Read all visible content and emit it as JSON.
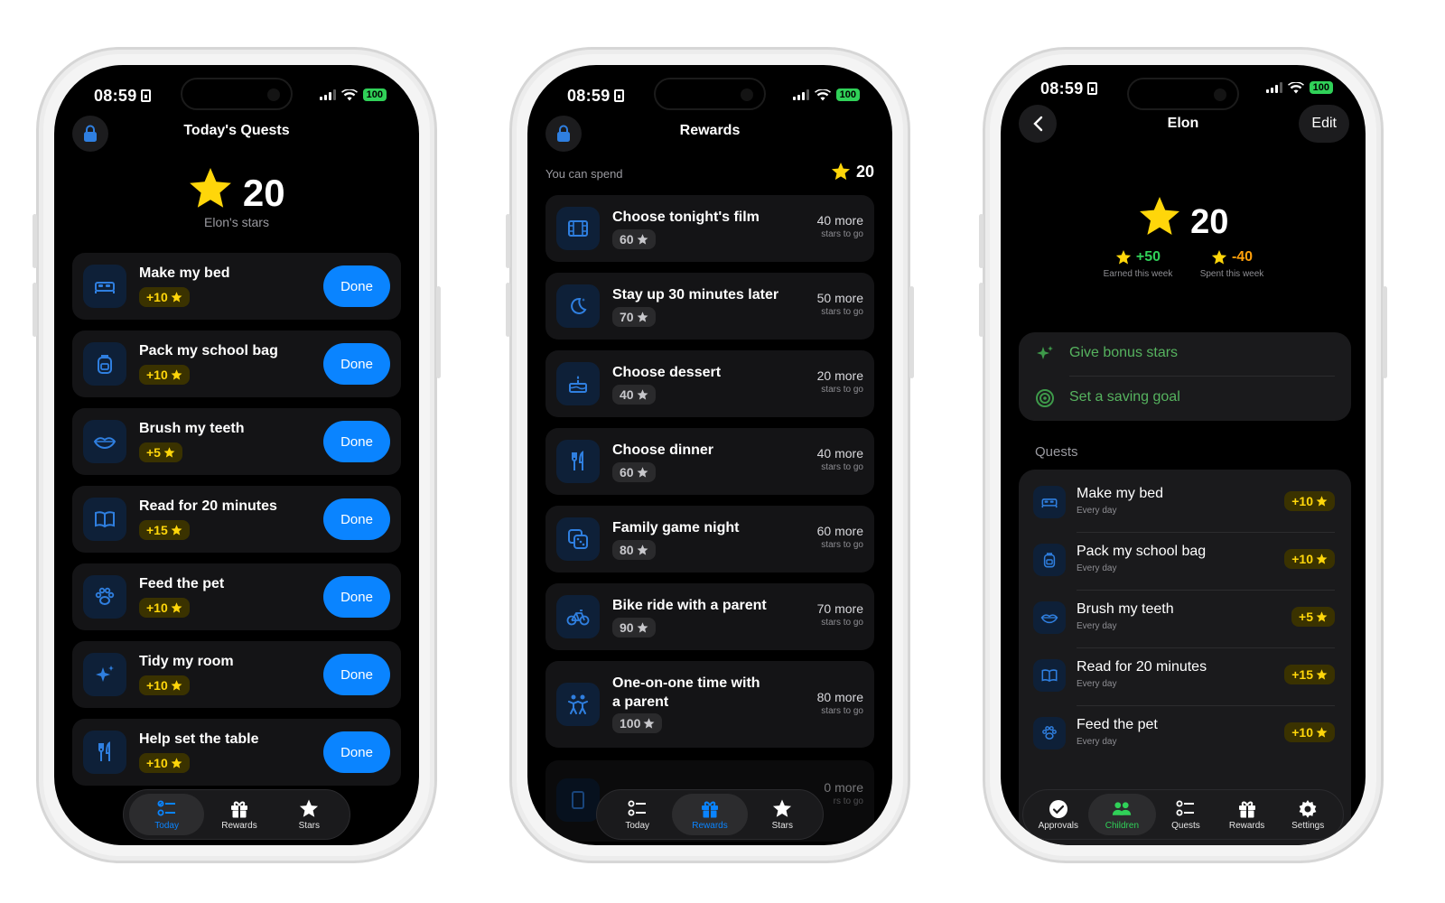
{
  "common": {
    "time": "08:59",
    "battery": "100"
  },
  "today": {
    "title": "Today's Quests",
    "stars": "20",
    "stars_label": "Elon's stars",
    "done_label": "Done",
    "quests": [
      {
        "title": "Make my bed",
        "points": "+10",
        "icon": "bed-icon"
      },
      {
        "title": "Pack my school bag",
        "points": "+10",
        "icon": "backpack-icon"
      },
      {
        "title": "Brush my teeth",
        "points": "+5",
        "icon": "lips-icon"
      },
      {
        "title": "Read for 20 minutes",
        "points": "+15",
        "icon": "book-icon"
      },
      {
        "title": "Feed the pet",
        "points": "+10",
        "icon": "paw-icon"
      },
      {
        "title": "Tidy my room",
        "points": "+10",
        "icon": "sparkle-icon"
      },
      {
        "title": "Help set the table",
        "points": "+10",
        "icon": "fork-knife-icon"
      }
    ],
    "tabs": [
      "Today",
      "Rewards",
      "Stars"
    ]
  },
  "rewards": {
    "title": "Rewards",
    "spend_label": "You can spend",
    "spend_value": "20",
    "items": [
      {
        "title": "Choose tonight's film",
        "cost": "60",
        "more": "40 more",
        "icon": "film-icon"
      },
      {
        "title": "Stay up 30 minutes later",
        "cost": "70",
        "more": "50 more",
        "icon": "moon-icon"
      },
      {
        "title": "Choose dessert",
        "cost": "40",
        "more": "20 more",
        "icon": "cake-icon"
      },
      {
        "title": "Choose dinner",
        "cost": "60",
        "more": "40 more",
        "icon": "fork-knife-icon"
      },
      {
        "title": "Family game night",
        "cost": "80",
        "more": "60 more",
        "icon": "dice-icon"
      },
      {
        "title": "Bike ride with a parent",
        "cost": "90",
        "more": "70 more",
        "icon": "bicycle-icon"
      },
      {
        "title": "One-on-one time with",
        "title2": "a parent",
        "cost": "100",
        "more": "80 more",
        "icon": "people-icon"
      }
    ],
    "partial_more": "0 more",
    "partial_sub": "rs to go",
    "stars_to_go": "stars to go",
    "tabs": [
      "Today",
      "Rewards",
      "Stars"
    ]
  },
  "child": {
    "name": "Elon",
    "edit": "Edit",
    "stars": "20",
    "earned": "+50",
    "earned_label": "Earned this week",
    "spent": "-40",
    "spent_label": "Spent this week",
    "actions": [
      {
        "label": "Give bonus stars",
        "icon": "sparkle-icon"
      },
      {
        "label": "Set a saving goal",
        "icon": "target-icon"
      }
    ],
    "quests_header": "Quests",
    "quests": [
      {
        "title": "Make my bed",
        "freq": "Every day",
        "points": "+10",
        "icon": "bed-icon"
      },
      {
        "title": "Pack my school bag",
        "freq": "Every day",
        "points": "+10",
        "icon": "backpack-icon"
      },
      {
        "title": "Brush my teeth",
        "freq": "Every day",
        "points": "+5",
        "icon": "lips-icon"
      },
      {
        "title": "Read for 20 minutes",
        "freq": "Every day",
        "points": "+15",
        "icon": "book-icon"
      },
      {
        "title": "Feed the pet",
        "freq": "Every day",
        "points": "+10",
        "icon": "paw-icon"
      }
    ],
    "tabs": [
      "Approvals",
      "Children",
      "Quests",
      "Rewards",
      "Settings"
    ]
  },
  "colors": {
    "accent": "#0a84ff",
    "gold": "#ffd60a",
    "green": "#30d158",
    "orange": "#ff9f0a"
  }
}
